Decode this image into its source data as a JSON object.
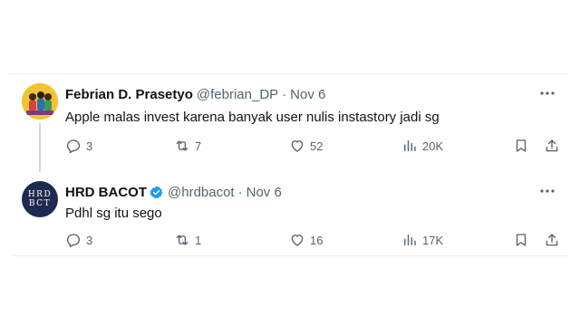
{
  "tweets": [
    {
      "name": "Febrian D. Prasetyo",
      "handle": "@febrian_DP",
      "separator": "·",
      "date": "Nov 6",
      "text": "Apple malas invest karena banyak user nulis instastory jadi sg",
      "replies": "3",
      "retweets": "7",
      "likes": "52",
      "views": "20K"
    },
    {
      "name": "HRD BACOT",
      "handle": "@hrdbacot",
      "separator": "·",
      "date": "Nov 6",
      "avatar_text_line1": "HRD",
      "avatar_text_line2": "BCT",
      "text": "Pdhl sg itu sego",
      "replies": "3",
      "retweets": "1",
      "likes": "16",
      "views": "17K"
    }
  ],
  "colors": {
    "text": "#0f1419",
    "secondary": "#536471",
    "verified": "#1d9bf0",
    "thread_line": "#cfd9de",
    "avatar_hrd_bg": "#1f2a50",
    "avatar_febrian_bg": "#f2c230"
  },
  "icons": [
    "more-icon",
    "reply-icon",
    "retweet-icon",
    "like-icon",
    "views-icon",
    "bookmark-icon",
    "share-icon",
    "verified-badge-icon"
  ]
}
